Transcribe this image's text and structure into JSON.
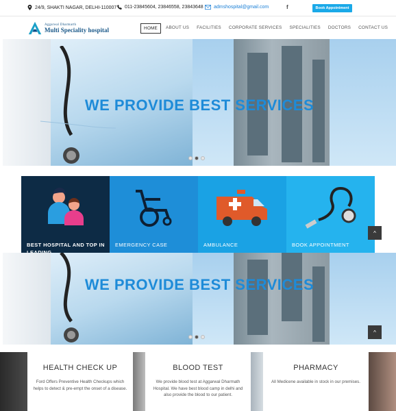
{
  "topbar": {
    "address": "24/9, SHAKTI NAGAR, DELHI-110007",
    "phone": "011-23845604, 23846558, 23843648",
    "email": "admshospital@gmail.com",
    "facebook": "f",
    "book_label": "Book Appointment"
  },
  "logo": {
    "sup": "Aggarwal Dharmarth",
    "main": "Multi Speciality hospital"
  },
  "menu": [
    "HOME",
    "ABOUT US",
    "FACILITIES",
    "CORPORATE SERVICES",
    "SPECIALITIES",
    "DOCTORS",
    "CONTACT US"
  ],
  "hero": {
    "title": "WE PROVIDE BEST SERVICES",
    "slides": 3,
    "active_slide": 2
  },
  "features": [
    {
      "label": "BEST HOSPITAL AND TOP IN LEADING",
      "icon": "doctors-icon"
    },
    {
      "label": "EMERGENCY CASE",
      "icon": "wheelchair-icon"
    },
    {
      "label": "AMBULANCE",
      "icon": "ambulance-icon"
    },
    {
      "label": "BOOK APPOINTMENT",
      "icon": "stethoscope-icon"
    }
  ],
  "scroll_top": "^",
  "services": [
    {
      "title": "HEALTH CHECK UP",
      "desc": "Ford Offers Preventive Health Checkups which helps to detect & pre-empt the onset of a disease."
    },
    {
      "title": "BLOOD TEST",
      "desc": "We provide blood test at Aggarwal Dharmath Hospital. We have best blood camp in delhi and also provide the blood to our patient."
    },
    {
      "title": "PHARMACY",
      "desc": "All Medicene available in stock in our premises."
    }
  ],
  "colors": {
    "accent": "#1e8ed8",
    "dark": "#0d2b45",
    "button": "#1aa9e8"
  }
}
